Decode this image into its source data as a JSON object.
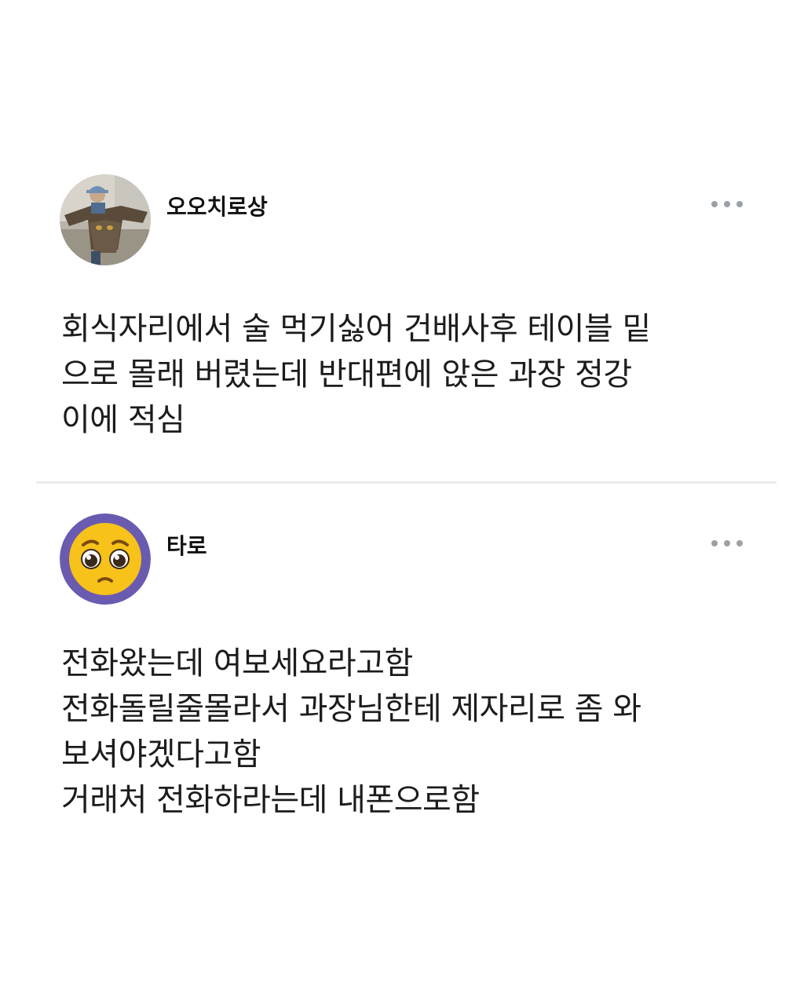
{
  "posts": [
    {
      "username": "오오치로상",
      "avatar_icon": "person-holding-owl-photo",
      "more_icon": "more-dots-icon",
      "body_lines": [
        "회식자리에서 술 먹기싫어 건배사후 테이블 밑",
        "으로 몰래 버렸는데 반대편에 앉은 과장 정강",
        "이에 적심"
      ]
    },
    {
      "username": "타로",
      "avatar_icon": "pleading-face-emoji",
      "more_icon": "more-dots-icon",
      "body_lines": [
        "전화왔는데 여보세요라고함",
        "전화돌릴줄몰라서 과장님한테 제자리로 좀 와",
        "보셔야겠다고함",
        "거래처 전화하라는데 내폰으로함"
      ]
    }
  ],
  "colors": {
    "background": "#ffffff",
    "divider": "#ececec",
    "dots": "#9aa0a6",
    "emoji_ring": "#6a5bb0",
    "emoji_face": "#f7c21a"
  }
}
